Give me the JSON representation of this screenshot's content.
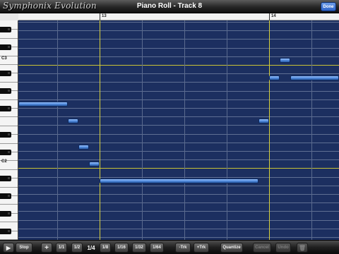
{
  "app": {
    "logo": "Symphonix Evolution",
    "title": "Piano Roll - Track 8",
    "done_label": "Done"
  },
  "ruler": {
    "bars": [
      "13",
      "14"
    ]
  },
  "keyboard": {
    "octave_labels": [
      "C3",
      "C2"
    ]
  },
  "toolbar": {
    "play_icon": "▶",
    "stop_label": "Stop",
    "add_label": "+",
    "grid_options": [
      "1/1",
      "1/2",
      "1/4",
      "1/8",
      "1/16",
      "1/32",
      "1/64"
    ],
    "selected_grid": "1/4",
    "minus_track_label": "-Trk",
    "plus_track_label": "+Trk",
    "quantize_label": "Quantize",
    "cancel_label": "Cancel",
    "undo_label": "Undo",
    "trash_icon": "🗑"
  },
  "colors": {
    "grid_background": "#1c2f60",
    "bar_line": "#d7cf3a",
    "note_fill": "#4d86d8",
    "done_button": "#2d63c8"
  }
}
